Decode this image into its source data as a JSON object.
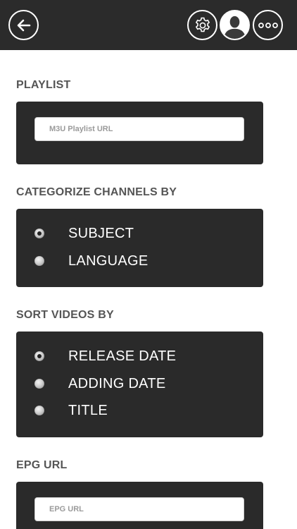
{
  "header": {
    "back_icon": "back-arrow-icon",
    "settings_icon": "gear-icon",
    "profile_icon": "user-avatar-icon",
    "more_icon": "more-dots-icon"
  },
  "playlist": {
    "title": "PLAYLIST",
    "placeholder": "M3U Playlist URL",
    "value": ""
  },
  "categorize": {
    "title": "CATEGORIZE CHANNELS BY",
    "options": [
      {
        "label": "SUBJECT",
        "selected": true
      },
      {
        "label": "LANGUAGE",
        "selected": false
      }
    ]
  },
  "sort": {
    "title": "SORT VIDEOS BY",
    "options": [
      {
        "label": "RELEASE DATE",
        "selected": true
      },
      {
        "label": "ADDING DATE",
        "selected": false
      },
      {
        "label": "TITLE",
        "selected": false
      }
    ]
  },
  "epg": {
    "title": "EPG URL",
    "placeholder": "EPG URL",
    "value": ""
  },
  "colors": {
    "header_bg": "#2b2b2b",
    "panel_bg": "#2a2a2a",
    "section_title": "#555555"
  }
}
